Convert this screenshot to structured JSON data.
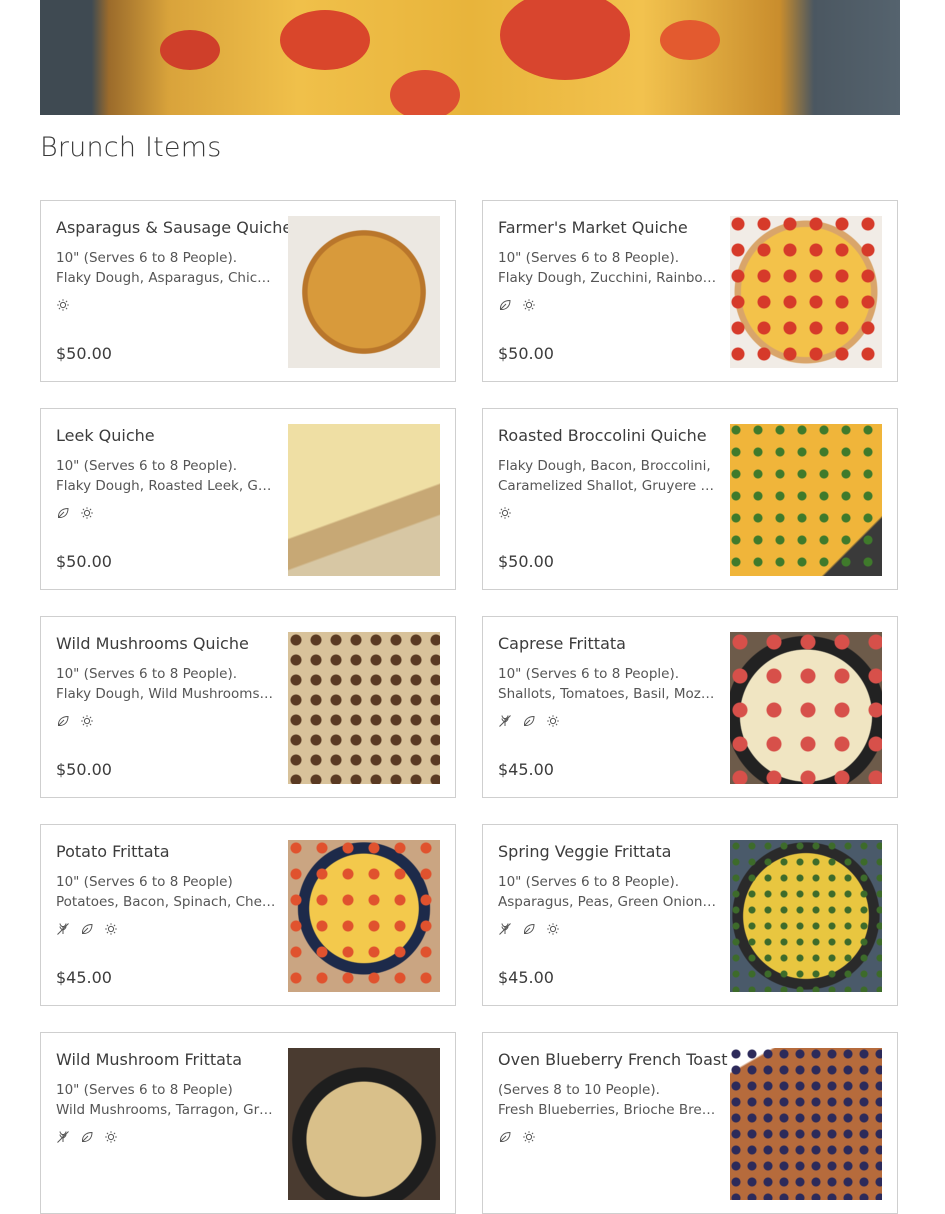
{
  "section": {
    "title": "Brunch Items"
  },
  "items": [
    {
      "name": "Asparagus & Sausage Quiche",
      "line1": "10\" (Serves 6 to 8 People).",
      "line2": "Flaky Dough, Asparagus, Chicken Sausage, Gruyere",
      "price": "$50.00",
      "badges": [
        "organic-sun-icon"
      ],
      "photo": "quiche-round"
    },
    {
      "name": "Farmer's Market Quiche",
      "line1": "10\" (Serves 6 to 8 People).",
      "line2": "Flaky Dough, Zucchini, Rainbow Tomatoes",
      "price": "$50.00",
      "badges": [
        "vegetarian-leaf-icon",
        "organic-sun-icon"
      ],
      "photo": "tart-tomato"
    },
    {
      "name": "Leek Quiche",
      "line1": "10\" (Serves 6 to 8 People).",
      "line2": "Flaky Dough, Roasted Leek, Gruyere",
      "price": "$50.00",
      "badges": [
        "vegetarian-leaf-icon",
        "organic-sun-icon"
      ],
      "photo": "quiche-slice"
    },
    {
      "name": "Roasted Broccolini Quiche",
      "line1": "Flaky Dough, Bacon, Broccolini,",
      "line2": "Caramelized Shallot, Gruyere Cheese",
      "price": "$50.00",
      "badges": [
        "organic-sun-icon"
      ],
      "photo": "quiche-broccolini"
    },
    {
      "name": "Wild Mushrooms Quiche",
      "line1": "10\" (Serves 6 to 8 People).",
      "line2": "Flaky Dough, Wild Mushrooms, Gruyere",
      "price": "$50.00",
      "badges": [
        "vegetarian-leaf-icon",
        "organic-sun-icon"
      ],
      "photo": "quiche-mushroom"
    },
    {
      "name": "Caprese Frittata",
      "line1": "10\" (Serves 6 to 8 People).",
      "line2": "Shallots, Tomatoes, Basil, Mozzarella",
      "price": "$45.00",
      "badges": [
        "gluten-free-icon",
        "vegetarian-leaf-icon",
        "organic-sun-icon"
      ],
      "photo": "frittata-caprese"
    },
    {
      "name": "Potato Frittata",
      "line1": "10\" (Serves 6 to 8 People)",
      "line2": "Potatoes, Bacon, Spinach, Cherry Tomatoes",
      "price": "$45.00",
      "badges": [
        "gluten-free-icon",
        "vegetarian-leaf-icon",
        "organic-sun-icon"
      ],
      "photo": "frittata-potato"
    },
    {
      "name": "Spring Veggie Frittata",
      "line1": "10\" (Serves 6 to 8 People).",
      "line2": "Asparagus, Peas, Green Onions, Feta",
      "price": "$45.00",
      "badges": [
        "gluten-free-icon",
        "vegetarian-leaf-icon",
        "organic-sun-icon"
      ],
      "photo": "frittata-spring"
    },
    {
      "name": "Wild Mushroom Frittata",
      "line1": "10\" (Serves 6 to 8 People)",
      "line2": "Wild Mushrooms, Tarragon, Gruyere",
      "price": "",
      "badges": [
        "gluten-free-icon",
        "vegetarian-leaf-icon",
        "organic-sun-icon"
      ],
      "photo": "frittata-mushroom"
    },
    {
      "name": "Oven Blueberry French Toast",
      "line1": "(Serves 8 to 10 People).",
      "line2": "Fresh Blueberries, Brioche Bread",
      "price": "",
      "badges": [
        "vegetarian-leaf-icon",
        "organic-sun-icon"
      ],
      "photo": "french-toast"
    }
  ],
  "colors": {
    "border": "#cfcfcf",
    "text": "#3c3c3c",
    "muted": "#555555"
  }
}
